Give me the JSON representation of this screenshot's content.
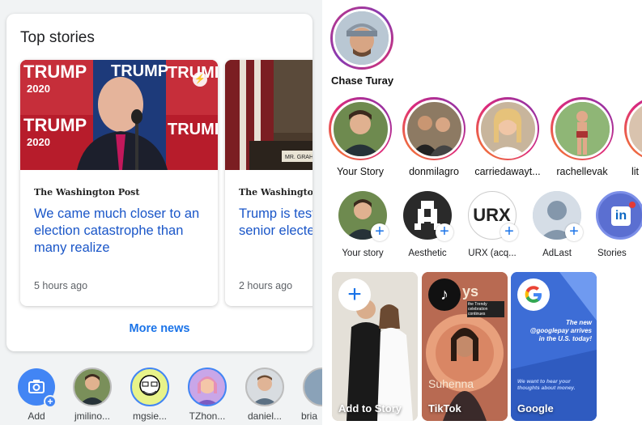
{
  "top_stories": {
    "title": "Top stories",
    "stories": [
      {
        "publisher": "The Washington Post",
        "headline": "We came much closer to an election catastrophe than many realize",
        "time": "5 hours ago",
        "image_sign": "TRUMP 2020"
      },
      {
        "publisher": "The Washington Post",
        "headline": "Trump is test democracy. N senior electe are failing.",
        "time": "2 hours ago",
        "image_sign": "MR. GRAHAM"
      }
    ],
    "more_label": "More news"
  },
  "bottom_row": {
    "add_label": "Add",
    "items": [
      "jmilino...",
      "mgsie...",
      "TZhon...",
      "daniel...",
      "bria"
    ]
  },
  "right_pane": {
    "main_name": "Chase Turay",
    "instagram_stories": [
      "Your Story",
      "donmilagro",
      "carriedawayt...",
      "rachellevak",
      "lit"
    ],
    "google_stories": [
      "Your story",
      "Aesthetic",
      "URX (acq...",
      "AdLast",
      "Stories"
    ],
    "urx_text": "URX",
    "tiles": [
      {
        "label": "Add to Story"
      },
      {
        "label": "TikTok",
        "overlay_title": "ys",
        "overlay_name": "Suhenna",
        "overlay_note": "the Trendy celebration continues"
      },
      {
        "label": "Google",
        "overlay_text": "The new @googlepay arrives in the U.S. today!",
        "overlay_sub": "We want to hear your thoughts about money."
      }
    ]
  },
  "colors": {
    "link_blue": "#1a56c8",
    "google_blue": "#1a73e8",
    "ig_gradient_start": "#f58529",
    "ig_gradient_end": "#8134af"
  }
}
